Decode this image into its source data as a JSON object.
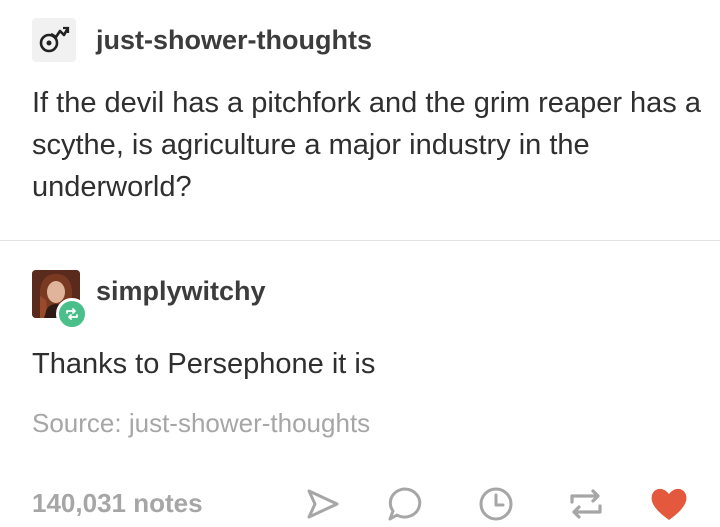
{
  "original_post": {
    "username": "just-shower-thoughts",
    "text": "If the devil has a pitchfork and the grim reaper has a scythe, is agriculture a major industry in the underworld?"
  },
  "reblog": {
    "username": "simplywitchy",
    "text": "Thanks to Persephone it is"
  },
  "source": "Source: just-shower-thoughts",
  "footer": {
    "notes": "140,031 notes",
    "icons": [
      "share-icon",
      "reply-icon",
      "queue-icon",
      "reblog-icon",
      "like-icon"
    ]
  },
  "colors": {
    "reblog_badge": "#4bbf89",
    "like": "#e4583d",
    "muted": "#a6a6a6"
  }
}
